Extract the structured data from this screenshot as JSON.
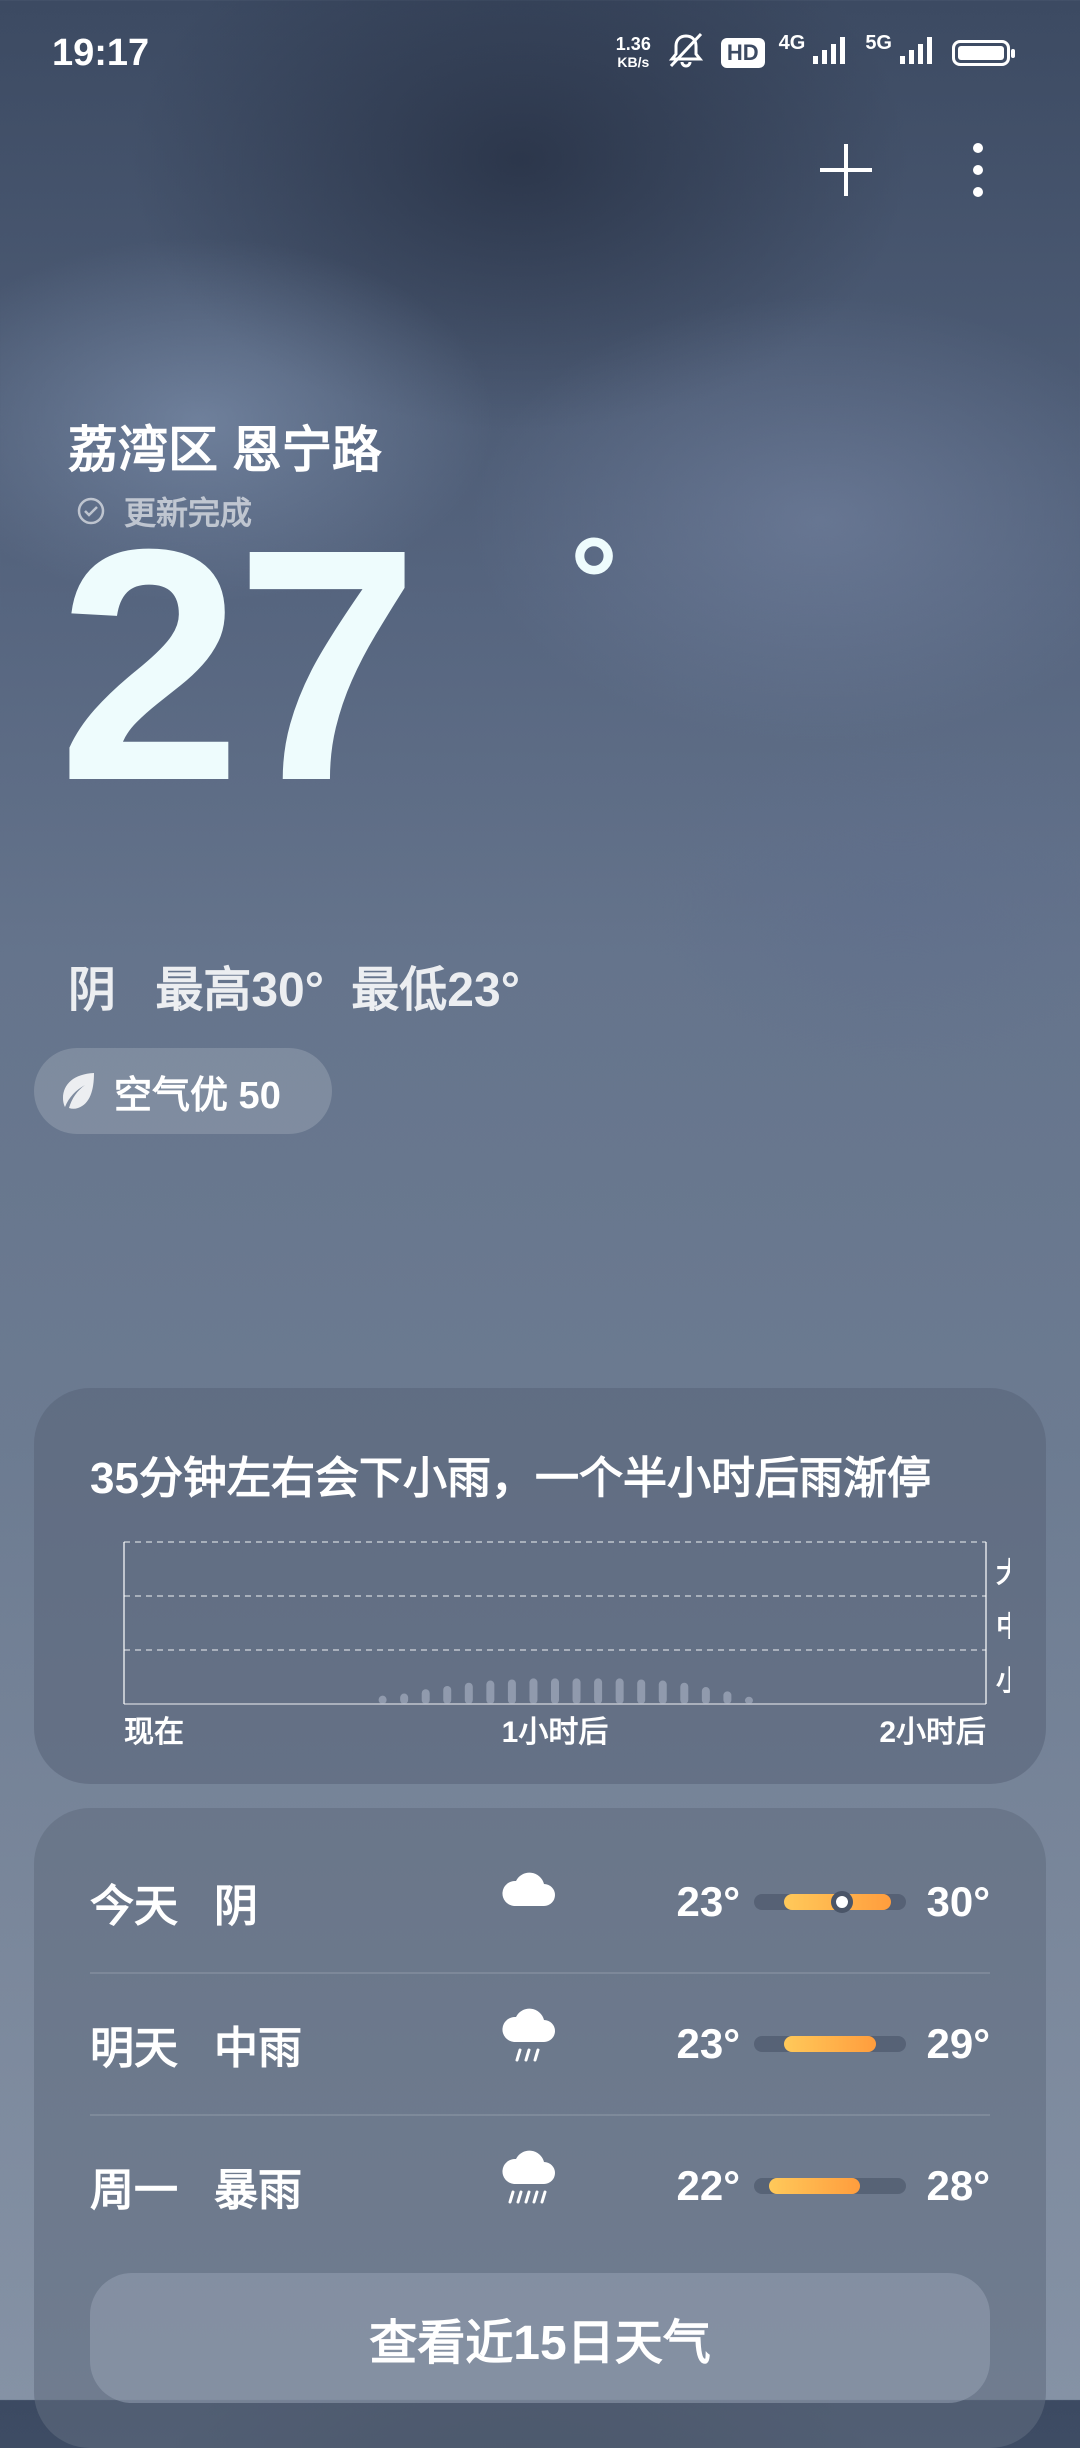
{
  "status": {
    "time": "19:17",
    "net_speed_value": "1.36",
    "net_speed_unit": "KB/s",
    "hd_label": "HD",
    "sig1_label": "4G",
    "sig2_label": "5G"
  },
  "location": {
    "name": "荔湾区 恩宁路",
    "update_status": "更新完成"
  },
  "current": {
    "temperature": "27",
    "degree_symbol": "°",
    "condition": "阴",
    "high_text": "最高30°",
    "low_text": "最低23°"
  },
  "air_quality": {
    "label": "空气优 50"
  },
  "rain_forecast": {
    "headline": "35分钟左右会下小雨，一个半小时后雨渐停",
    "y_labels": [
      "大",
      "中",
      "小"
    ],
    "x_labels": [
      "现在",
      "1小时后",
      "2小时后"
    ]
  },
  "chart_data": {
    "type": "bar",
    "x_range": [
      0,
      120
    ],
    "y_categories": [
      "小",
      "中",
      "大"
    ],
    "x_tick_labels": [
      "现在",
      "1小时后",
      "2小时后"
    ],
    "title": "35分钟左右会下小雨，一个半小时后雨渐停",
    "grid": true,
    "series": [
      {
        "x": [
          36,
          39,
          42,
          45,
          48,
          51,
          54,
          57,
          60,
          63,
          66,
          69,
          72,
          75,
          78,
          81,
          84,
          87
        ],
        "values": [
          0.08,
          0.12,
          0.2,
          0.26,
          0.32,
          0.36,
          0.38,
          0.4,
          0.4,
          0.4,
          0.4,
          0.4,
          0.38,
          0.36,
          0.32,
          0.24,
          0.16,
          0.06
        ]
      }
    ]
  },
  "forecast": {
    "days": [
      {
        "day": "今天",
        "condition": "阴",
        "icon": "cloud-icon",
        "low": "23°",
        "high": "30°",
        "range_start": 0.2,
        "range_end": 0.9,
        "current_marker": 0.58
      },
      {
        "day": "明天",
        "condition": "中雨",
        "icon": "rain-cloud-icon",
        "low": "23°",
        "high": "29°",
        "range_start": 0.2,
        "range_end": 0.8
      },
      {
        "day": "周一",
        "condition": "暴雨",
        "icon": "heavy-rain-cloud-icon",
        "low": "22°",
        "high": "28°",
        "range_start": 0.1,
        "range_end": 0.7
      }
    ],
    "more_button": "查看近15日天气"
  },
  "colors": {
    "temp_text": "#eefcfd",
    "bar_gradient_start": "#ffc95a",
    "bar_gradient_end": "#ff9d3d"
  }
}
